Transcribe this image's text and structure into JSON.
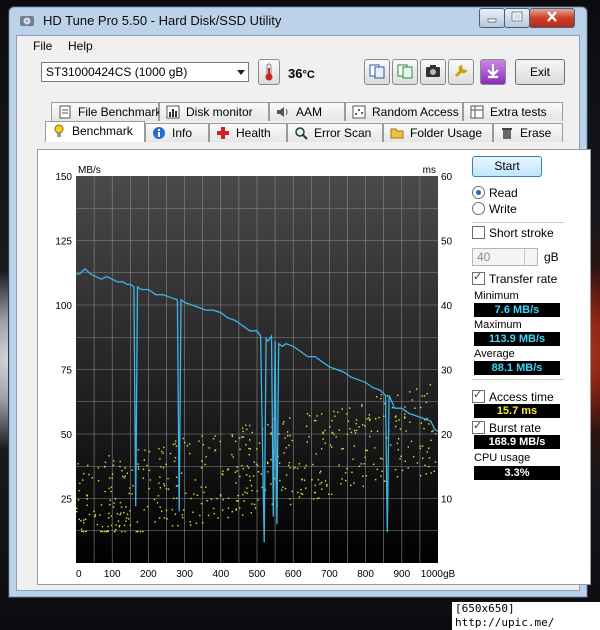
{
  "window": {
    "title": "HD Tune Pro 5.50 - Hard Disk/SSD Utility"
  },
  "menu": [
    {
      "label": "File"
    },
    {
      "label": "Help"
    }
  ],
  "toolbar": {
    "drive": "ST31000424CS (1000 gB)",
    "temperature": "36",
    "temperature_unit": "°C",
    "exit_label": "Exit"
  },
  "tabs_top": [
    {
      "label": "File Benchmark"
    },
    {
      "label": "Disk monitor"
    },
    {
      "label": "AAM"
    },
    {
      "label": "Random Access"
    },
    {
      "label": "Extra tests"
    }
  ],
  "tabs_bottom": [
    {
      "label": "Benchmark"
    },
    {
      "label": "Info"
    },
    {
      "label": "Health"
    },
    {
      "label": "Error Scan"
    },
    {
      "label": "Folder Usage"
    },
    {
      "label": "Erase"
    }
  ],
  "controls": {
    "start_label": "Start",
    "read_label": "Read",
    "write_label": "Write",
    "short_stroke_label": "Short stroke",
    "short_stroke_value": "40",
    "short_stroke_unit": "gB",
    "transfer_rate_label": "Transfer rate",
    "access_time_label": "Access time",
    "burst_rate_label": "Burst rate",
    "cpu_usage_label": "CPU usage"
  },
  "stats": {
    "minimum_label": "Minimum",
    "minimum": "7.6 MB/s",
    "maximum_label": "Maximum",
    "maximum": "113.9 MB/s",
    "average_label": "Average",
    "average": "88.1 MB/s",
    "access_time": "15.7 ms",
    "burst_rate": "168.9 MB/s",
    "cpu_usage": "3.3%"
  },
  "caption": "[650x650] http://upic.me/",
  "colors": {
    "transfer_line": "#3fb3e6",
    "access_dots": "#e0e044",
    "plot_bg": "#000000",
    "grid": "#8a8a8a"
  },
  "chart_data": {
    "type": "line",
    "xlabel": "",
    "x_ticks": [
      "0",
      "100",
      "200",
      "300",
      "400",
      "500",
      "600",
      "700",
      "800",
      "900",
      "1000gB"
    ],
    "y_left_label": "MB/s",
    "y_left_ticks": [
      "150",
      "125",
      "100",
      "75",
      "50",
      "25"
    ],
    "y_right_label": "ms",
    "y_right_ticks": [
      "60",
      "50",
      "40",
      "30",
      "20",
      "10"
    ],
    "xlim": [
      0,
      1000
    ],
    "ylim_left": [
      0,
      150
    ],
    "ylim_right": [
      0,
      60
    ],
    "series": [
      {
        "axis": "left",
        "x": [
          0,
          10,
          25,
          40,
          55,
          70,
          85,
          100,
          115,
          130,
          140,
          150,
          160,
          165,
          170,
          180,
          200,
          220,
          240,
          260,
          280,
          285,
          290,
          300,
          320,
          340,
          360,
          380,
          400,
          420,
          440,
          460,
          480,
          500,
          510,
          520,
          525,
          530,
          540,
          545,
          550,
          555,
          560,
          570,
          580,
          600,
          620,
          640,
          660,
          680,
          700,
          720,
          740,
          760,
          780,
          800,
          820,
          840,
          855,
          860,
          865,
          880,
          900,
          920,
          940,
          960,
          980,
          990,
          1000
        ],
        "y": [
          112,
          112,
          114,
          112,
          111,
          110,
          111,
          110,
          109,
          109,
          108,
          108,
          107,
          22,
          107,
          106,
          106,
          104,
          104,
          103,
          102,
          20,
          102,
          101,
          100,
          99,
          98,
          98,
          97,
          95,
          94,
          92,
          90,
          90,
          88,
          8,
          87,
          86,
          88,
          18,
          86,
          15,
          85,
          84,
          85,
          84,
          82,
          80,
          80,
          78,
          76,
          75,
          74,
          72,
          71,
          70,
          68,
          67,
          65,
          12,
          65,
          60,
          60,
          58,
          57,
          56,
          55,
          52,
          51
        ]
      }
    ],
    "access_time_scatter": {
      "axis": "right",
      "description_units": "ms",
      "approx_range_ms": [
        5,
        30
      ]
    }
  }
}
